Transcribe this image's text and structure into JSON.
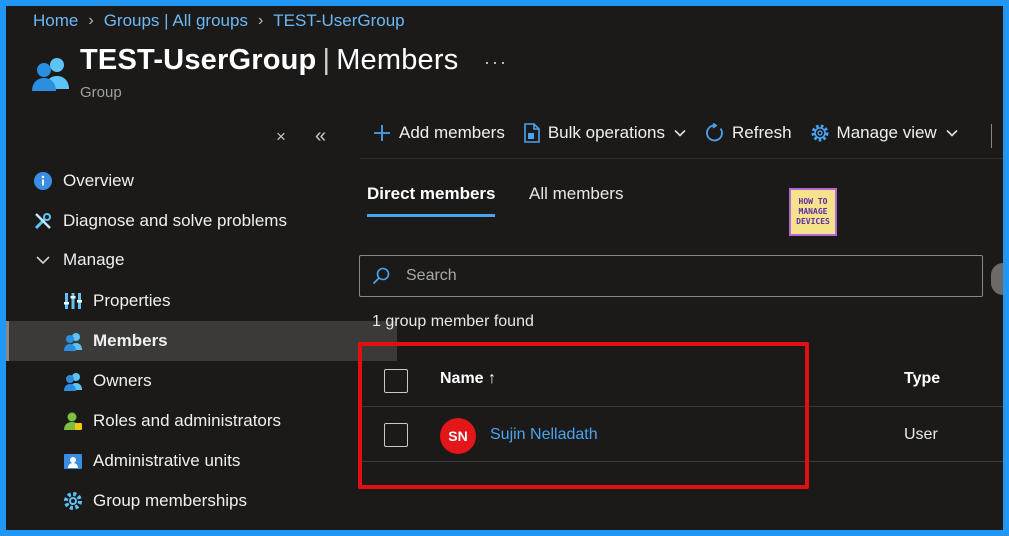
{
  "breadcrumb": [
    "Home",
    "Groups | All groups",
    "TEST-UserGroup"
  ],
  "header": {
    "title_name": "TEST-UserGroup",
    "title_section": "Members",
    "more": "···",
    "subtitle": "Group"
  },
  "sidebar": {
    "close": "×",
    "collapse": "«",
    "items": [
      {
        "label": "Overview"
      },
      {
        "label": "Diagnose and solve problems"
      },
      {
        "label": "Manage"
      },
      {
        "label": "Properties"
      },
      {
        "label": "Members"
      },
      {
        "label": "Owners"
      },
      {
        "label": "Roles and administrators"
      },
      {
        "label": "Administrative units"
      },
      {
        "label": "Group memberships"
      }
    ]
  },
  "toolbar": {
    "add_members": "Add members",
    "bulk_operations": "Bulk operations",
    "refresh": "Refresh",
    "manage_view": "Manage view"
  },
  "tabs": [
    {
      "label": "Direct members",
      "active": true
    },
    {
      "label": "All members",
      "active": false
    }
  ],
  "logo": {
    "line1": "HOW TO",
    "line2": "MANAGE",
    "line3": "DEVICES"
  },
  "search": {
    "placeholder": "Search",
    "value": ""
  },
  "result_count": "1 group member found",
  "table": {
    "columns": [
      "Name ↑",
      "Type"
    ],
    "rows": [
      {
        "initials": "SN",
        "name": "Sujin Nelladath",
        "type": "User"
      }
    ]
  },
  "colors": {
    "accent": "#4aa3f0",
    "highlight_box": "#e01010",
    "avatar": "#e3161a"
  }
}
